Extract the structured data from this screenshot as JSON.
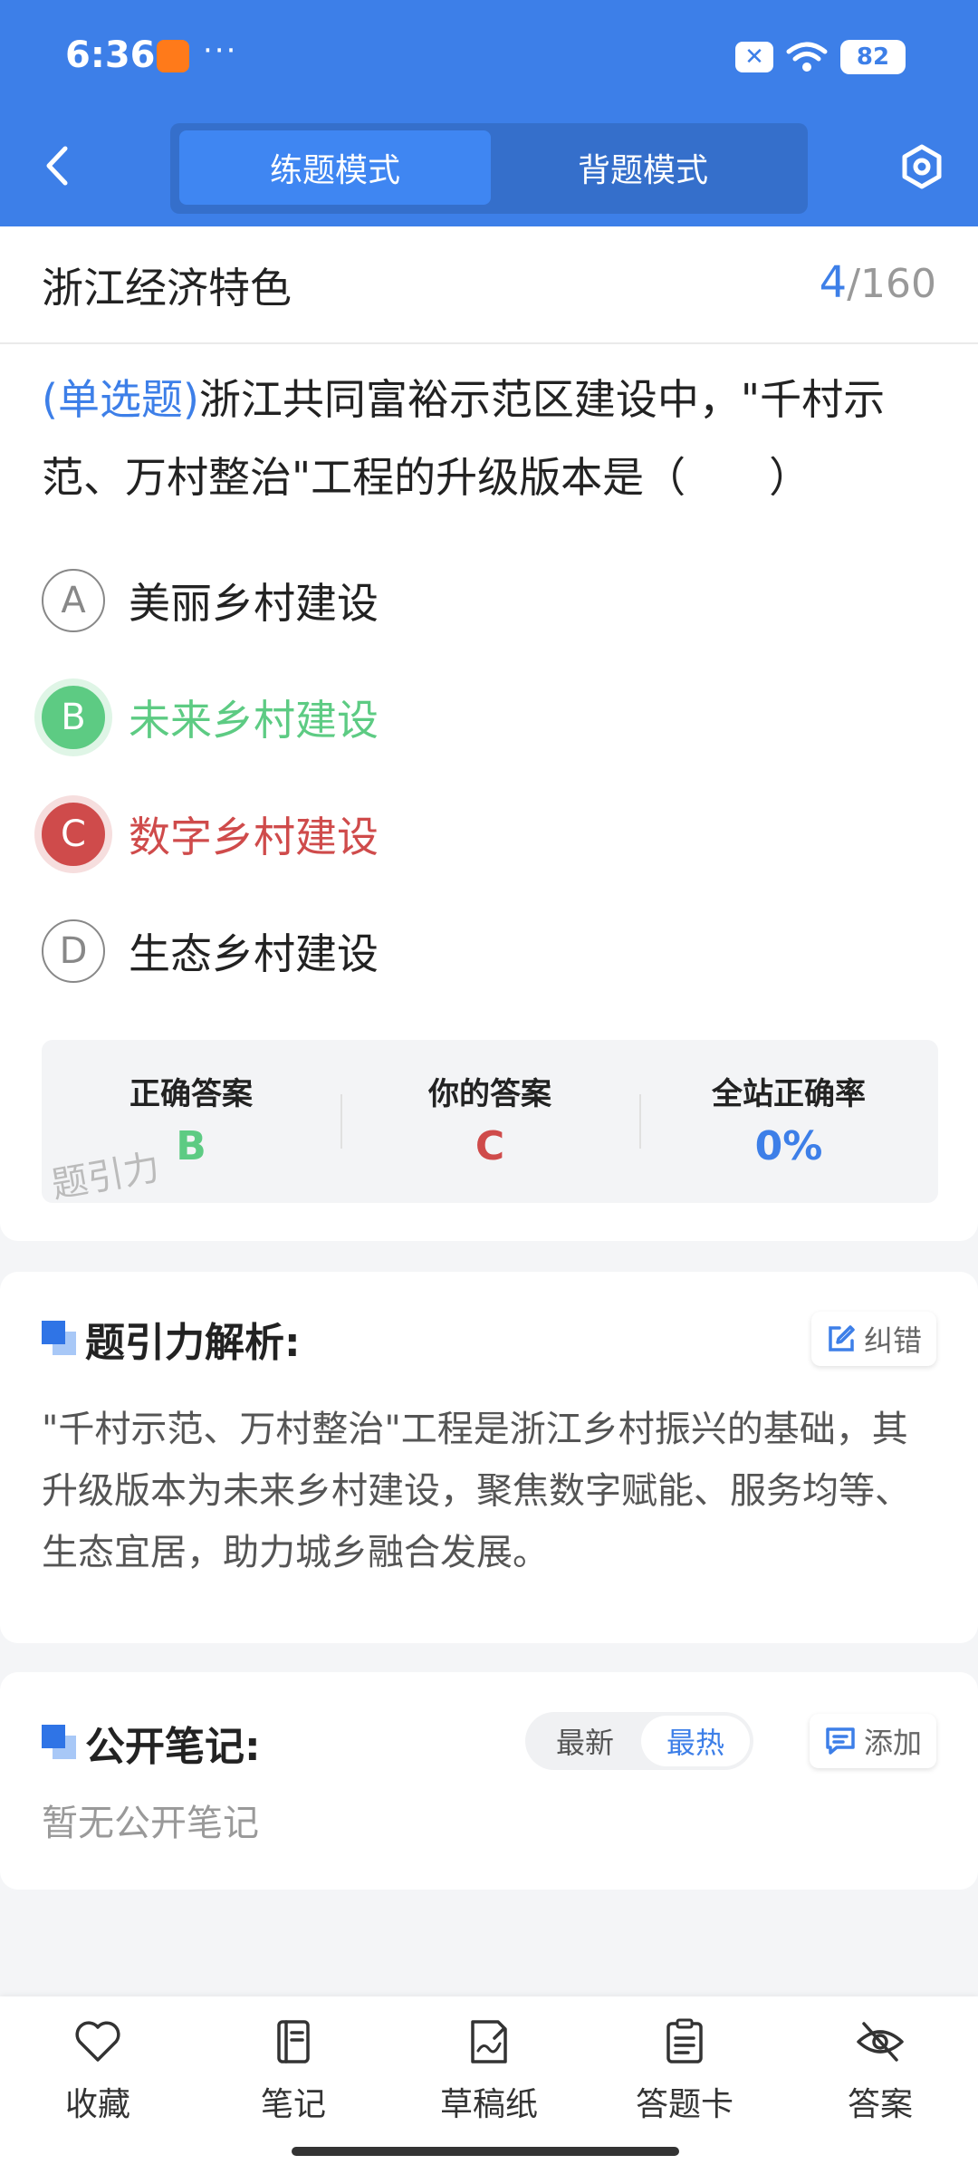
{
  "status_bar": {
    "time": "6:36",
    "dots": "···",
    "sim": "✕",
    "battery": "82"
  },
  "header": {
    "tabs": [
      {
        "label": "练题模式",
        "active": true
      },
      {
        "label": "背题模式",
        "active": false
      }
    ],
    "back_icon": "chevron-left-icon",
    "settings_icon": "hexagon-gear-icon"
  },
  "question": {
    "chapter": "浙江经济特色",
    "counter_current": "4",
    "counter_total": "/160",
    "type_label": "(单选题)",
    "text": "浙江共同富裕示范区建设中，\"千村示范、万村整治\"工程的升级版本是（　　）",
    "options": [
      {
        "letter": "A",
        "text": "美丽乡村建设",
        "state": "normal"
      },
      {
        "letter": "B",
        "text": "未来乡村建设",
        "state": "correct"
      },
      {
        "letter": "C",
        "text": "数字乡村建设",
        "state": "wrong"
      },
      {
        "letter": "D",
        "text": "生态乡村建设",
        "state": "normal"
      }
    ]
  },
  "answer_summary": {
    "correct_label": "正确答案",
    "correct_value": "B",
    "yours_label": "你的答案",
    "yours_value": "C",
    "rate_label": "全站正确率",
    "rate_value": "0%",
    "watermark": "题引力"
  },
  "analysis": {
    "title": "题引力解析:",
    "report_label": "纠错",
    "text": "\"千村示范、万村整治\"工程是浙江乡村振兴的基础，其升级版本为未来乡村建设，聚焦数字赋能、服务均等、生态宜居，助力城乡融合发展。"
  },
  "notes": {
    "title": "公开笔记:",
    "sort_latest": "最新",
    "sort_hot": "最热",
    "add_label": "添加",
    "empty_text": "暂无公开笔记"
  },
  "bottom_bar": [
    {
      "label": "收藏",
      "icon": "heart-icon"
    },
    {
      "label": "笔记",
      "icon": "notebook-icon"
    },
    {
      "label": "草稿纸",
      "icon": "draft-paper-icon"
    },
    {
      "label": "答题卡",
      "icon": "answer-sheet-icon"
    },
    {
      "label": "答案",
      "icon": "eye-off-icon"
    }
  ],
  "colors": {
    "primary": "#3d7fe8",
    "correct": "#5dcb83",
    "wrong": "#cf4b4b"
  }
}
